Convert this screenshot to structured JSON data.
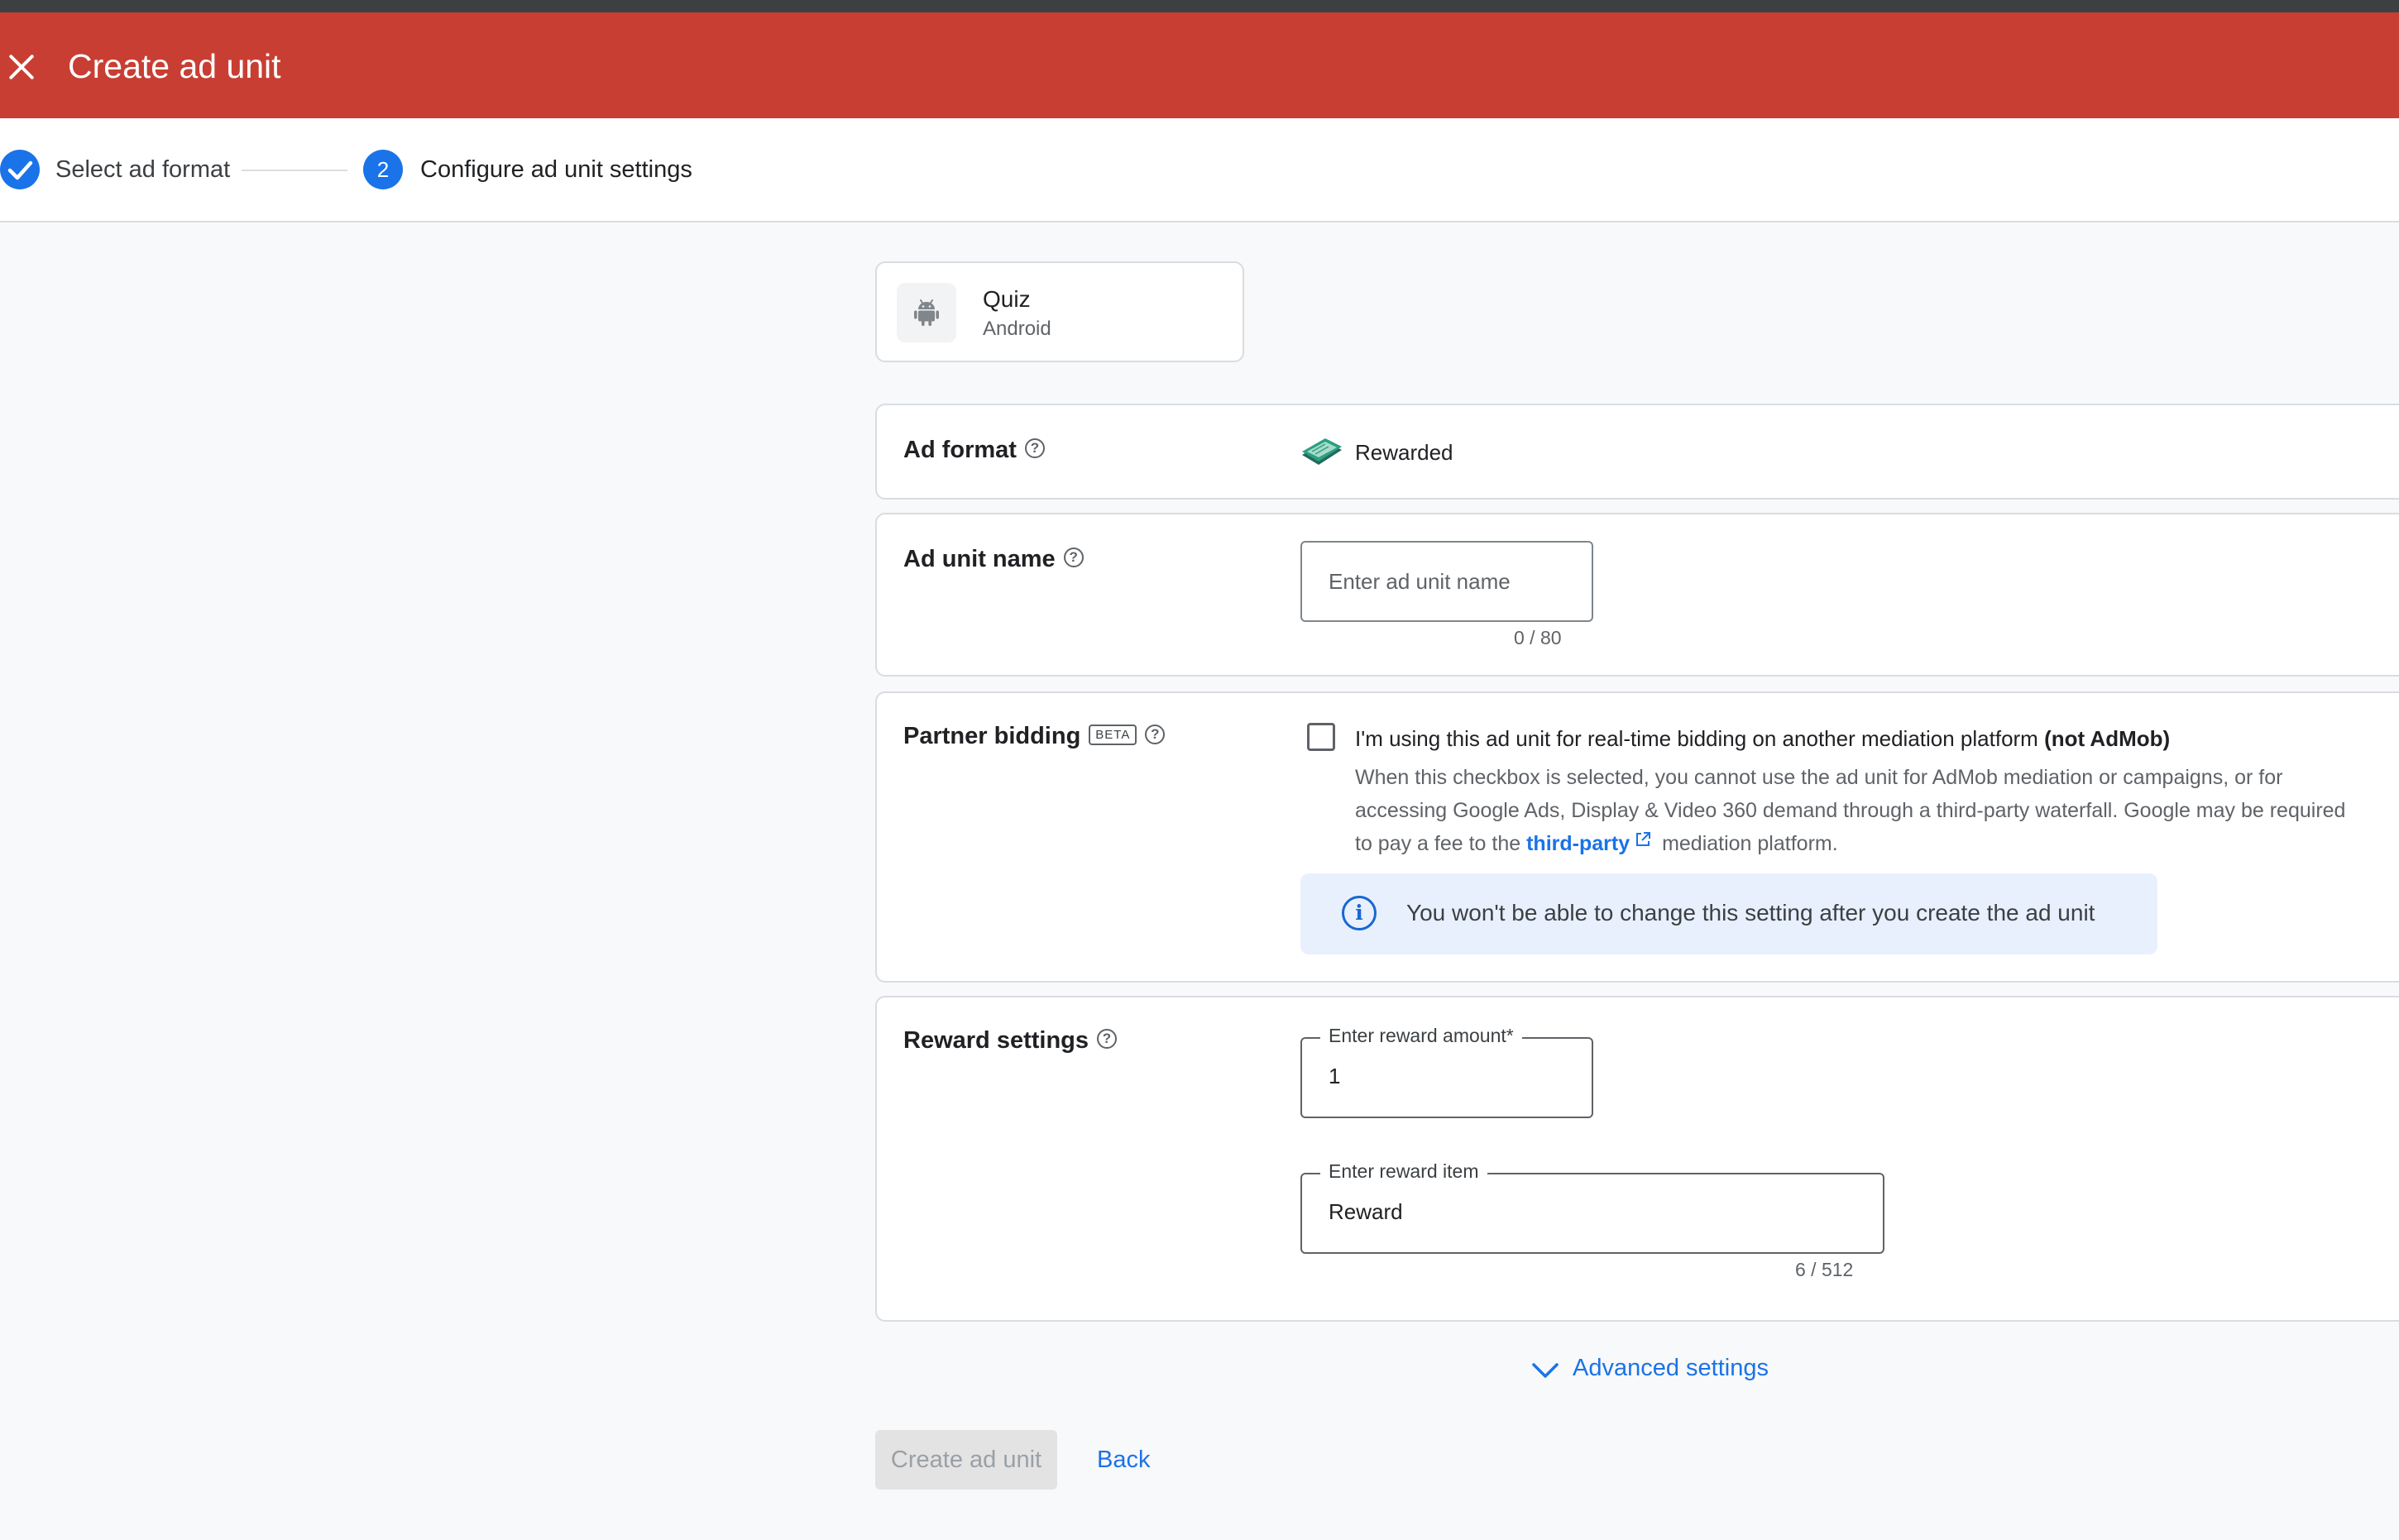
{
  "header": {
    "title": "Create ad unit",
    "close_icon": "close-icon"
  },
  "stepper": {
    "steps": [
      {
        "label": "Select ad format",
        "state": "complete"
      },
      {
        "number": "2",
        "label": "Configure ad unit settings",
        "state": "current"
      }
    ]
  },
  "app": {
    "name": "Quiz",
    "platform": "Android",
    "icon": "android-icon"
  },
  "ad_format": {
    "label": "Ad format",
    "value": "Rewarded",
    "icon": "rewarded-format-icon"
  },
  "ad_unit_name": {
    "label": "Ad unit name",
    "placeholder": "Enter ad unit name",
    "counter": "0 / 80"
  },
  "partner_bidding": {
    "label": "Partner bidding",
    "badge": "BETA",
    "checkbox_label": "I'm using this ad unit for real-time bidding on another mediation platform",
    "checkbox_label_bold": "(not AdMob)",
    "help_line1": "When this checkbox is selected, you cannot use the ad unit for AdMob mediation or campaigns, or for",
    "help_line2": "accessing Google Ads, Display & Video 360 demand through a third-party waterfall. Google may be required",
    "help_line3_before": "to pay a fee to the",
    "help_link": "third-party",
    "help_line3_after": "mediation platform.",
    "checked": false,
    "info_banner": "You won't be able to change this setting after you create the ad unit"
  },
  "reward_settings": {
    "label": "Reward settings",
    "amount_label": "Enter reward amount*",
    "amount_value": "1",
    "item_label": "Enter reward item",
    "item_value": "Reward",
    "item_counter": "6 / 512"
  },
  "advanced_settings": "Advanced settings",
  "actions": {
    "create": "Create ad unit",
    "back": "Back"
  },
  "colors": {
    "app_bar": "#c83e33",
    "accent": "#1a73e8",
    "info_bg": "#e8f0fe"
  }
}
